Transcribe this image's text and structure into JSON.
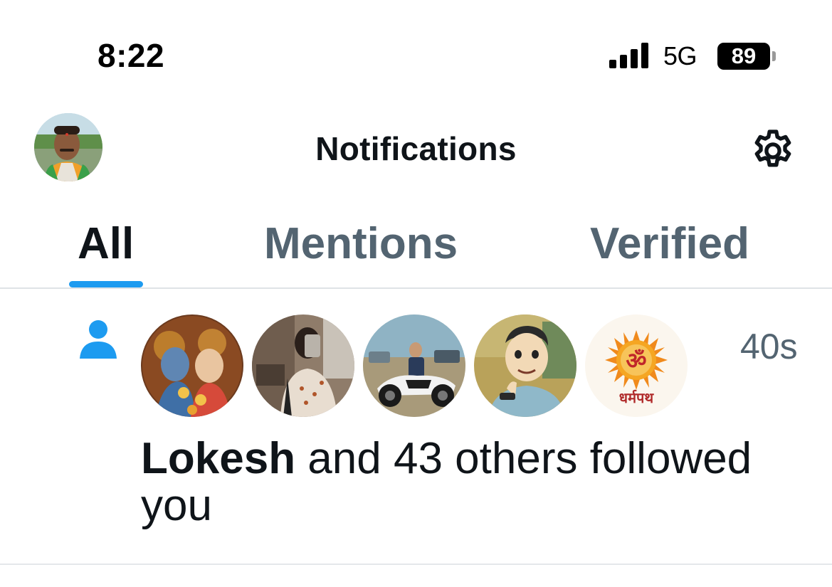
{
  "status_bar": {
    "time": "8:22",
    "network": "5G",
    "battery": "89",
    "signal_bars": 4
  },
  "header": {
    "title": "Notifications",
    "avatar_icon": "profile-avatar",
    "settings_icon": "gear-icon"
  },
  "tabs": [
    {
      "label": "All",
      "active": true
    },
    {
      "label": "Mentions",
      "active": false
    },
    {
      "label": "Verified",
      "active": false
    }
  ],
  "notification": {
    "type_icon": "person-icon",
    "timestamp": "40s",
    "actor": "Lokesh",
    "message": " and 43 others followed you",
    "follower_avatars": [
      {
        "name": "follower-avatar-deities"
      },
      {
        "name": "follower-avatar-mirror-selfie"
      },
      {
        "name": "follower-avatar-motorcycle"
      },
      {
        "name": "follower-avatar-cartoon-man"
      },
      {
        "name": "follower-avatar-dharmpath",
        "label": "धर्मपथ",
        "glyph": "ॐ"
      }
    ]
  },
  "colors": {
    "accent": "#1d9bf0",
    "text_primary": "#0f1419",
    "text_secondary": "#536471"
  }
}
